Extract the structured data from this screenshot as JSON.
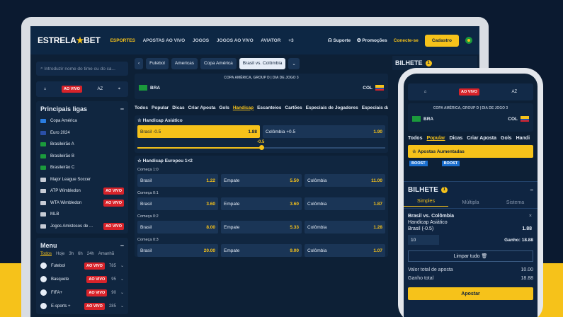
{
  "header": {
    "logo_left": "ESTRELA",
    "logo_right": "BET",
    "nav": [
      "ESPORTES",
      "APOSTAS AO VIVO",
      "JOGOS",
      "JOGOS AO VIVO",
      "AVIATOR",
      "+3"
    ],
    "support": "Suporte",
    "promos": "Promoções",
    "login": "Conecte-se",
    "signup": "Cadastro"
  },
  "sidebar": {
    "search_placeholder": "Introduzir nome do time ou do ca...",
    "live_badge": "AO VIVO",
    "az": "AZ",
    "leagues_title": "Principais ligas",
    "leagues": [
      {
        "name": "Copa América",
        "color": "#2a7de1",
        "tag": ""
      },
      {
        "name": "Euro 2024",
        "color": "#2a4fa8",
        "tag": ""
      },
      {
        "name": "Brasileirão A",
        "color": "#1b9a3c",
        "tag": ""
      },
      {
        "name": "Brasileirão B",
        "color": "#1b9a3c",
        "tag": ""
      },
      {
        "name": "Brasileirão C",
        "color": "#1b9a3c",
        "tag": ""
      },
      {
        "name": "Major League Soccer",
        "color": "#c7ccd6",
        "tag": ""
      },
      {
        "name": "ATP Wimbledon",
        "color": "#c7ccd6",
        "tag": "AO VIVO"
      },
      {
        "name": "WTA Wimbledon",
        "color": "#c7ccd6",
        "tag": "AO VIVO"
      },
      {
        "name": "MLB",
        "color": "#c7ccd6",
        "tag": ""
      },
      {
        "name": "Jogos Amistosos de ...",
        "color": "#c7ccd6",
        "tag": "AO VIVO"
      }
    ],
    "menu_title": "Menu",
    "menu_tabs": [
      "Todos",
      "Hoje",
      "3h",
      "6h",
      "24h",
      "Amanhã"
    ],
    "sports": [
      {
        "name": "Futebol",
        "tag": "AO VIVO",
        "count": "785"
      },
      {
        "name": "Basquete",
        "tag": "AO VIVO",
        "count": "95"
      },
      {
        "name": "FIFA+",
        "tag": "AO VIVO",
        "count": "90"
      },
      {
        "name": "E-sports +",
        "tag": "AO VIVO",
        "count": "285"
      }
    ]
  },
  "center": {
    "crumbs": [
      "Futebol",
      "Americas",
      "Copa América",
      "Brasil vs. Colômbia"
    ],
    "competition": "COPA AMÉRICA, GROUP D  |  DIA DE JOGO  3",
    "team_home": "BRA",
    "team_away": "COL",
    "market_tabs": [
      "Todos",
      "Popular",
      "Dicas",
      "Criar Aposta",
      "Gols",
      "Handicap",
      "Escanteios",
      "Cartões",
      "Especiais de Jogadores",
      "Especiais da Equipe"
    ],
    "asian": {
      "title": "Handicap Asiático",
      "home_label": "Brasil -0.5",
      "home_odd": "1.88",
      "away_label": "Colômbia +0.5",
      "away_odd": "1.90",
      "slider_label": "-0.5",
      "slider_fraction": 0.5
    },
    "euro": {
      "title": "Handicap Europeu 1×2",
      "groups": [
        {
          "sub": "Começa 1:0",
          "odds": [
            [
              "Brasil",
              "1.22"
            ],
            [
              "Empate",
              "5.50"
            ],
            [
              "Colômbia",
              "11.00"
            ]
          ]
        },
        {
          "sub": "Começa 0:1",
          "odds": [
            [
              "Brasil",
              "3.60"
            ],
            [
              "Empate",
              "3.60"
            ],
            [
              "Colômbia",
              "1.87"
            ]
          ]
        },
        {
          "sub": "Começa 0:2",
          "odds": [
            [
              "Brasil",
              "8.00"
            ],
            [
              "Empate",
              "5.33"
            ],
            [
              "Colômbia",
              "1.28"
            ]
          ]
        },
        {
          "sub": "Começa 0:3",
          "odds": [
            [
              "Brasil",
              "20.00"
            ],
            [
              "Empate",
              "9.00"
            ],
            [
              "Colômbia",
              "1.07"
            ]
          ]
        }
      ]
    }
  },
  "bilhete": {
    "title": "BILHETE",
    "count": "1"
  },
  "phone": {
    "live_badge": "AO VIVO",
    "az": "AZ",
    "competition": "COPA AMÉRICA, GROUP D  |  DIA DE JOGO  3",
    "team_home": "BRA",
    "team_away": "COL",
    "tabs": [
      "Todos",
      "Popular",
      "Dicas",
      "Criar Aposta",
      "Gols",
      "Handi"
    ],
    "boost_title": "Apostas Aumentadas",
    "boost_tag": "BOOST",
    "slip_title": "BILHETE",
    "slip_count": "1",
    "slip_tabs": [
      "Simples",
      "Múltipla",
      "Sistema"
    ],
    "bet_match": "Brasil vs. Colômbia",
    "bet_market": "Handicap Asiático",
    "bet_pick": "Brasil (-0.5)",
    "bet_odd": "1.88",
    "stake": "10",
    "gain_label": "Ganho: 18.88",
    "clear": "Limpar tudo",
    "total_label": "Valor total de aposta",
    "total_value": "10.00",
    "gain_total_label": "Ganho total",
    "gain_total_value": "18.88",
    "bet_button": "Apostar"
  }
}
